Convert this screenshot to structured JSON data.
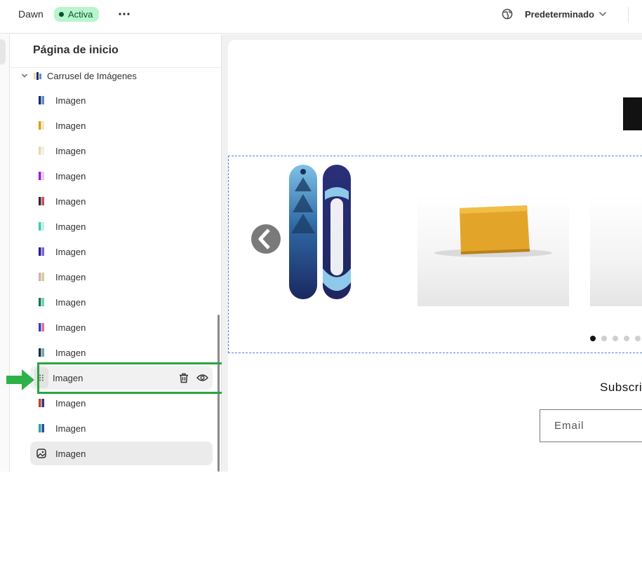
{
  "topbar": {
    "theme_name": "Dawn",
    "status": "Activa",
    "status_color": "#b7f5cd",
    "more_icon": "more-horizontal-icon",
    "globe_icon": "globe-icon",
    "preset": "Predeterminado"
  },
  "sidebar": {
    "title": "Página de inicio",
    "section": {
      "label": "Carrusel de Imágenes",
      "icon": "image-stack-icon",
      "expanded": true
    },
    "blocks": [
      {
        "label": "Imagen",
        "state": "normal",
        "thumb_colors": [
          "#1d2a6b",
          "#5a8fc7"
        ]
      },
      {
        "label": "Imagen",
        "state": "normal",
        "thumb_colors": [
          "#d7a20e",
          "#f0e6c0"
        ]
      },
      {
        "label": "Imagen",
        "state": "normal",
        "thumb_colors": [
          "#e9d9b0",
          "#f4efe3"
        ]
      },
      {
        "label": "Imagen",
        "state": "normal",
        "thumb_colors": [
          "#9b1fd1",
          "#e5c8f3"
        ]
      },
      {
        "label": "Imagen",
        "state": "normal",
        "thumb_colors": [
          "#3b2432",
          "#c54d5b"
        ]
      },
      {
        "label": "Imagen",
        "state": "normal",
        "thumb_colors": [
          "#3fc5b8",
          "#b9efe8"
        ]
      },
      {
        "label": "Imagen",
        "state": "normal",
        "thumb_colors": [
          "#2d1a8a",
          "#7b5ee2"
        ]
      },
      {
        "label": "Imagen",
        "state": "normal",
        "thumb_colors": [
          "#e2a7b9",
          "#c1d88a"
        ]
      },
      {
        "label": "Imagen",
        "state": "normal",
        "thumb_colors": [
          "#1f6f5a",
          "#67d6a5"
        ]
      },
      {
        "label": "Imagen",
        "state": "normal",
        "thumb_colors": [
          "#3c3fae",
          "#e06aa7"
        ]
      },
      {
        "label": "Imagen",
        "state": "normal",
        "thumb_colors": [
          "#1c2c4a",
          "#6fa6a0"
        ]
      },
      {
        "label": "Imagen",
        "state": "hovered",
        "thumb_colors": []
      },
      {
        "label": "Imagen",
        "state": "normal",
        "thumb_colors": [
          "#c63b3b",
          "#2d3a7a"
        ]
      },
      {
        "label": "Imagen",
        "state": "normal",
        "thumb_colors": [
          "#2aa3a8",
          "#2b4aa0"
        ]
      },
      {
        "label": "Imagen",
        "state": "selected",
        "thumb_colors": []
      }
    ],
    "hover_actions": {
      "delete_icon": "trash-icon",
      "visibility_icon": "eye-icon"
    },
    "highlight_color": "#27a644"
  },
  "preview": {
    "carousel": {
      "prev_icon": "chevron-left-icon",
      "slides": [
        "snowboard",
        "wax-bar",
        "product"
      ],
      "dots_total": 5,
      "dots_active": 0
    },
    "newsletter": {
      "heading": "Subscri",
      "email_placeholder": "Email"
    }
  }
}
